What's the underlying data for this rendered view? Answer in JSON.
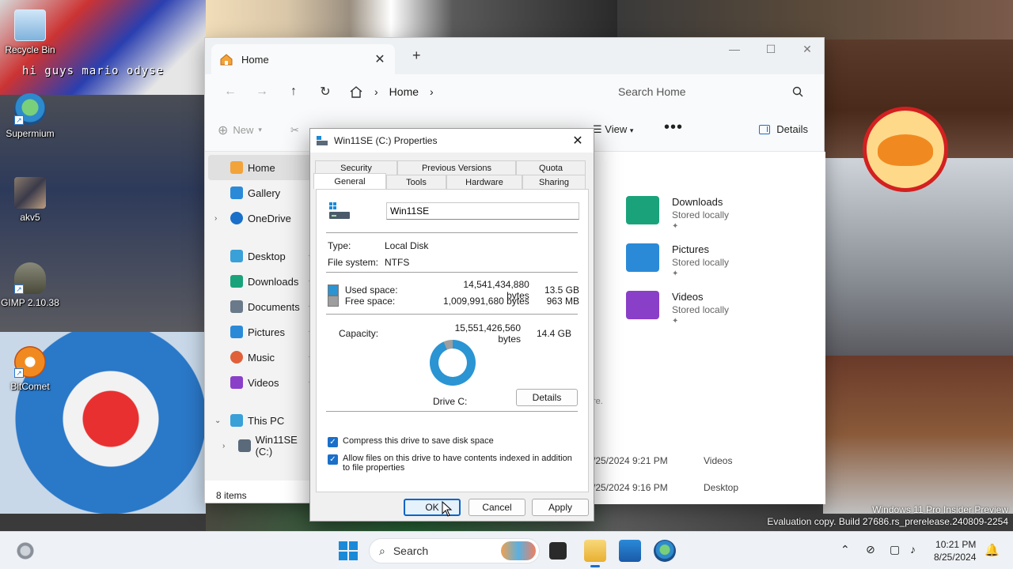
{
  "desktop": {
    "wallpaper_text": "hi guys mario odyse",
    "icons": [
      {
        "label": "Recycle Bin",
        "icon": "recycle-bin-icon"
      },
      {
        "label": "Supermium",
        "icon": "supermium-browser-icon"
      },
      {
        "label": "akv5",
        "icon": "image-file-icon"
      },
      {
        "label": "GIMP 2.10.38",
        "icon": "gimp-icon"
      },
      {
        "label": "BitComet",
        "icon": "bitcomet-icon"
      }
    ],
    "watermark": {
      "line1": "Windows 11 Pro Insider Preview",
      "line2": "Evaluation copy. Build 27686.rs_prerelease.240809-2254"
    }
  },
  "explorer": {
    "tab_title": "Home",
    "tab_close": "✕",
    "new_tab": "+",
    "window_controls": {
      "minimize": "—",
      "maximize": "☐",
      "close": "✕"
    },
    "nav": {
      "back": "←",
      "forward": "→",
      "up": "↑",
      "refresh": "↻"
    },
    "breadcrumb": {
      "root": "Home",
      "sep": "›"
    },
    "search_placeholder": "Search Home",
    "command_bar": {
      "new_label": "New",
      "view_label": "View",
      "more": "•••",
      "details_label": "Details"
    },
    "nav_pane": {
      "home": "Home",
      "gallery": "Gallery",
      "onedrive": "OneDrive",
      "desktop": "Desktop",
      "downloads": "Downloads",
      "documents": "Documents",
      "pictures": "Pictures",
      "music": "Music",
      "videos": "Videos",
      "this_pc": "This PC",
      "drive": "Win11SE (C:)"
    },
    "quick_access": [
      {
        "name": "Downloads",
        "status": "Stored locally",
        "color": "#1aa37a"
      },
      {
        "name": "Pictures",
        "status": "Stored locally",
        "color": "#2b8ad8"
      },
      {
        "name": "Videos",
        "status": "Stored locally",
        "color": "#8a3fc8"
      }
    ],
    "fragment_text": "re.",
    "recent": [
      {
        "date": "/25/2024 9:21 PM",
        "location": "Videos"
      },
      {
        "date": "/25/2024 9:16 PM",
        "location": "Desktop"
      }
    ],
    "status": "8 items"
  },
  "dialog": {
    "title": "Win11SE (C:) Properties",
    "close": "✕",
    "tabs_row1": [
      "Security",
      "Previous Versions",
      "Quota"
    ],
    "tabs_row2": [
      "General",
      "Tools",
      "Hardware",
      "Sharing"
    ],
    "active_tab": "General",
    "volume_name": "Win11SE",
    "type_label": "Type:",
    "type_value": "Local Disk",
    "fs_label": "File system:",
    "fs_value": "NTFS",
    "used_label": "Used space:",
    "used_bytes": "14,541,434,880 bytes",
    "used_gb": "13.5 GB",
    "free_label": "Free space:",
    "free_bytes": "1,009,991,680 bytes",
    "free_gb": "963 MB",
    "capacity_label": "Capacity:",
    "capacity_bytes": "15,551,426,560 bytes",
    "capacity_gb": "14.4 GB",
    "used_fraction": 0.935,
    "used_color": "#2b94d3",
    "free_color": "#9e9e9e",
    "drive_label": "Drive C:",
    "details_button": "Details",
    "compress_label": "Compress this drive to save disk space",
    "compress_checked": true,
    "index_label": "Allow files on this drive to have contents indexed in addition to file properties",
    "index_checked": true,
    "ok": "OK",
    "cancel": "Cancel",
    "apply": "Apply"
  },
  "taskbar": {
    "search_label": "Search",
    "time": "10:21 PM",
    "date": "8/25/2024",
    "apps": [
      "terminal-icon",
      "file-explorer-icon",
      "microsoft-store-icon",
      "supermium-browser-icon"
    ]
  }
}
